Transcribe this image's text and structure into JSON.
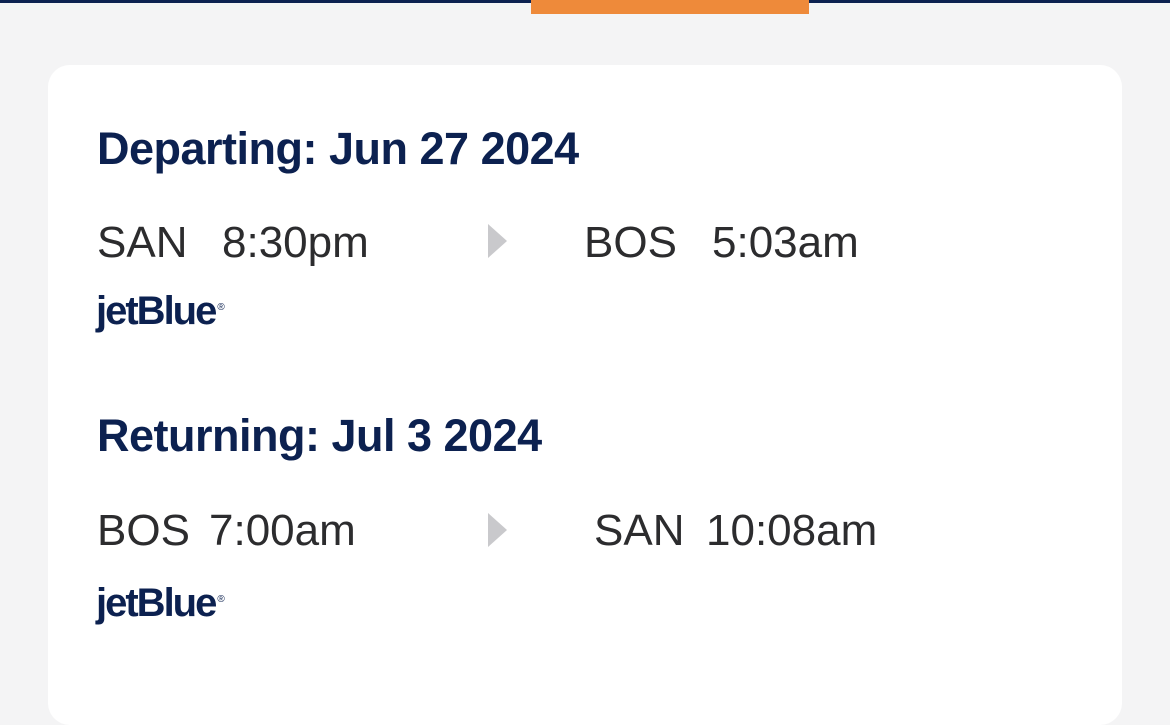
{
  "colors": {
    "navy": "#0c2150",
    "accent_orange": "#ee8a3a",
    "text_dark": "#2c2c2e",
    "arrow_gray": "#c9c9cc",
    "page_background": "#f4f4f5",
    "card_background": "#ffffff"
  },
  "departing": {
    "heading": "Departing: Jun 27 2024",
    "origin_code": "SAN",
    "origin_time": "8:30pm",
    "destination_code": "BOS",
    "destination_time": "5:03am",
    "direction_icon": "triangle-right-icon",
    "airline": "jetBlue",
    "airline_mark": "®"
  },
  "returning": {
    "heading": "Returning: Jul 3 2024",
    "origin_code": "BOS",
    "origin_time": "7:00am",
    "destination_code": "SAN",
    "destination_time": "10:08am",
    "direction_icon": "triangle-right-icon",
    "airline": "jetBlue",
    "airline_mark": "®"
  }
}
